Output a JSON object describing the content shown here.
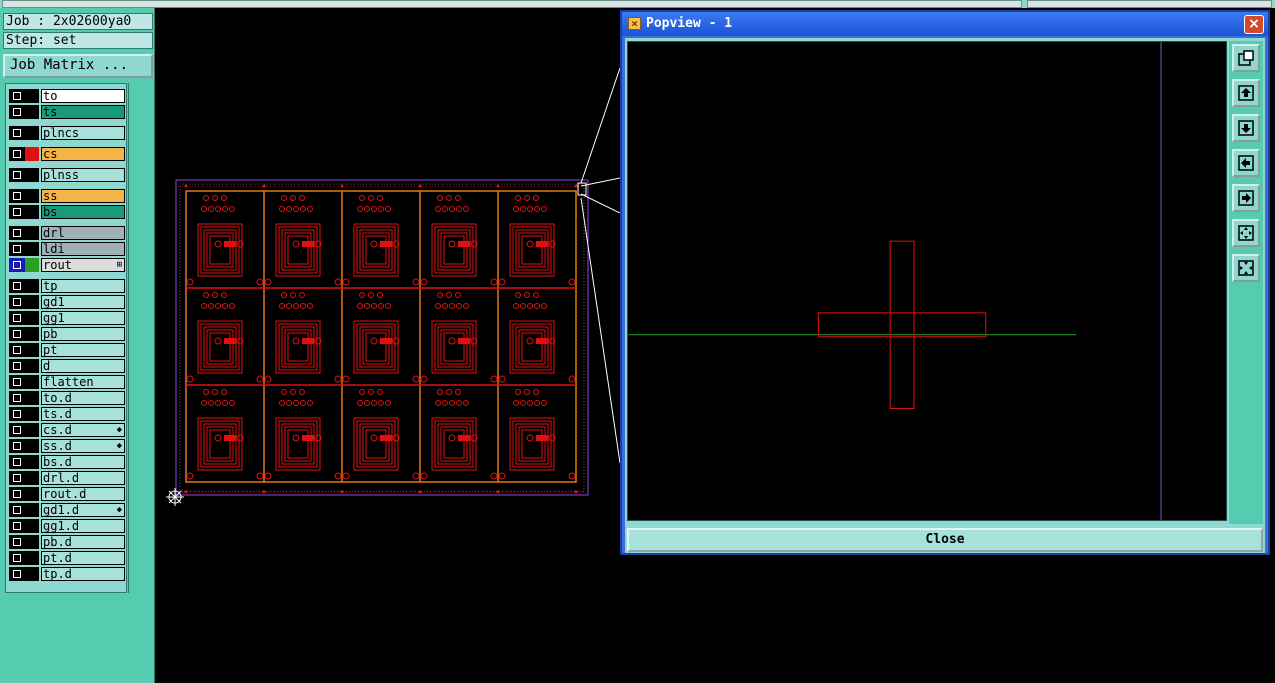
{
  "job_label": "Job : 2x02600ya0",
  "step_label": "Step: set",
  "job_matrix_button": "Job Matrix ...",
  "layers": [
    {
      "name": "to",
      "bg": "#ffffff",
      "swatch": "#000000"
    },
    {
      "name": "ts",
      "bg": "#1a9a78",
      "swatch": "#000000"
    },
    {
      "name": "plncs",
      "bg": "#a8e0da",
      "swatch": "#000000"
    },
    {
      "name": "cs",
      "bg": "#f5b447",
      "swatch": "#e01010"
    },
    {
      "name": "plnss",
      "bg": "#a8e0da",
      "swatch": "#000000"
    },
    {
      "name": "ss",
      "bg": "#f5b447",
      "swatch": "#000000"
    },
    {
      "name": "bs",
      "bg": "#1a9a78",
      "swatch": "#000000"
    },
    {
      "name": "drl",
      "bg": "#a0b0b8",
      "swatch": "#000000"
    },
    {
      "name": "ldi",
      "bg": "#a0b0b8",
      "swatch": "#000000"
    },
    {
      "name": "rout",
      "bg": "#dcdcdc",
      "swatch": "#2aa020",
      "selected": true,
      "mark": "⊞"
    },
    {
      "name": "tp",
      "bg": "#a8e0da",
      "swatch": "#000000"
    },
    {
      "name": "gd1",
      "bg": "#a8e0da",
      "swatch": "#000000"
    },
    {
      "name": "gg1",
      "bg": "#a8e0da",
      "swatch": "#000000"
    },
    {
      "name": "pb",
      "bg": "#a8e0da",
      "swatch": "#000000"
    },
    {
      "name": "pt",
      "bg": "#a8e0da",
      "swatch": "#000000"
    },
    {
      "name": "d",
      "bg": "#a8e0da",
      "swatch": "#000000"
    },
    {
      "name": "flatten",
      "bg": "#a8e0da",
      "swatch": "#000000"
    },
    {
      "name": "to.d",
      "bg": "#a8e0da",
      "swatch": "#000000"
    },
    {
      "name": "ts.d",
      "bg": "#a8e0da",
      "swatch": "#000000"
    },
    {
      "name": "cs.d",
      "bg": "#a8e0da",
      "swatch": "#000000",
      "mark": "◆"
    },
    {
      "name": "ss.d",
      "bg": "#a8e0da",
      "swatch": "#000000",
      "mark": "◆"
    },
    {
      "name": "bs.d",
      "bg": "#a8e0da",
      "swatch": "#000000"
    },
    {
      "name": "drl.d",
      "bg": "#a8e0da",
      "swatch": "#000000"
    },
    {
      "name": "rout.d",
      "bg": "#a8e0da",
      "swatch": "#000000"
    },
    {
      "name": "gd1.d",
      "bg": "#a8e0da",
      "swatch": "#000000",
      "mark": "◆"
    },
    {
      "name": "gg1.d",
      "bg": "#a8e0da",
      "swatch": "#000000"
    },
    {
      "name": "pb.d",
      "bg": "#a8e0da",
      "swatch": "#000000"
    },
    {
      "name": "pt.d",
      "bg": "#a8e0da",
      "swatch": "#000000"
    },
    {
      "name": "tp.d",
      "bg": "#a8e0da",
      "swatch": "#000000"
    }
  ],
  "popview": {
    "title": "Popview - 1",
    "close_button": "Close",
    "close_icon": "×",
    "tools": [
      "zoom-window-icon",
      "pan-up-icon",
      "pan-down-icon",
      "pan-left-icon",
      "pan-right-icon",
      "zoom-out-icon",
      "zoom-fit-icon"
    ]
  },
  "board": {
    "columns": 5,
    "rows": 3,
    "colors": {
      "outline": "#8a48e0",
      "copper": "#e01010",
      "route": "#e07818"
    }
  }
}
